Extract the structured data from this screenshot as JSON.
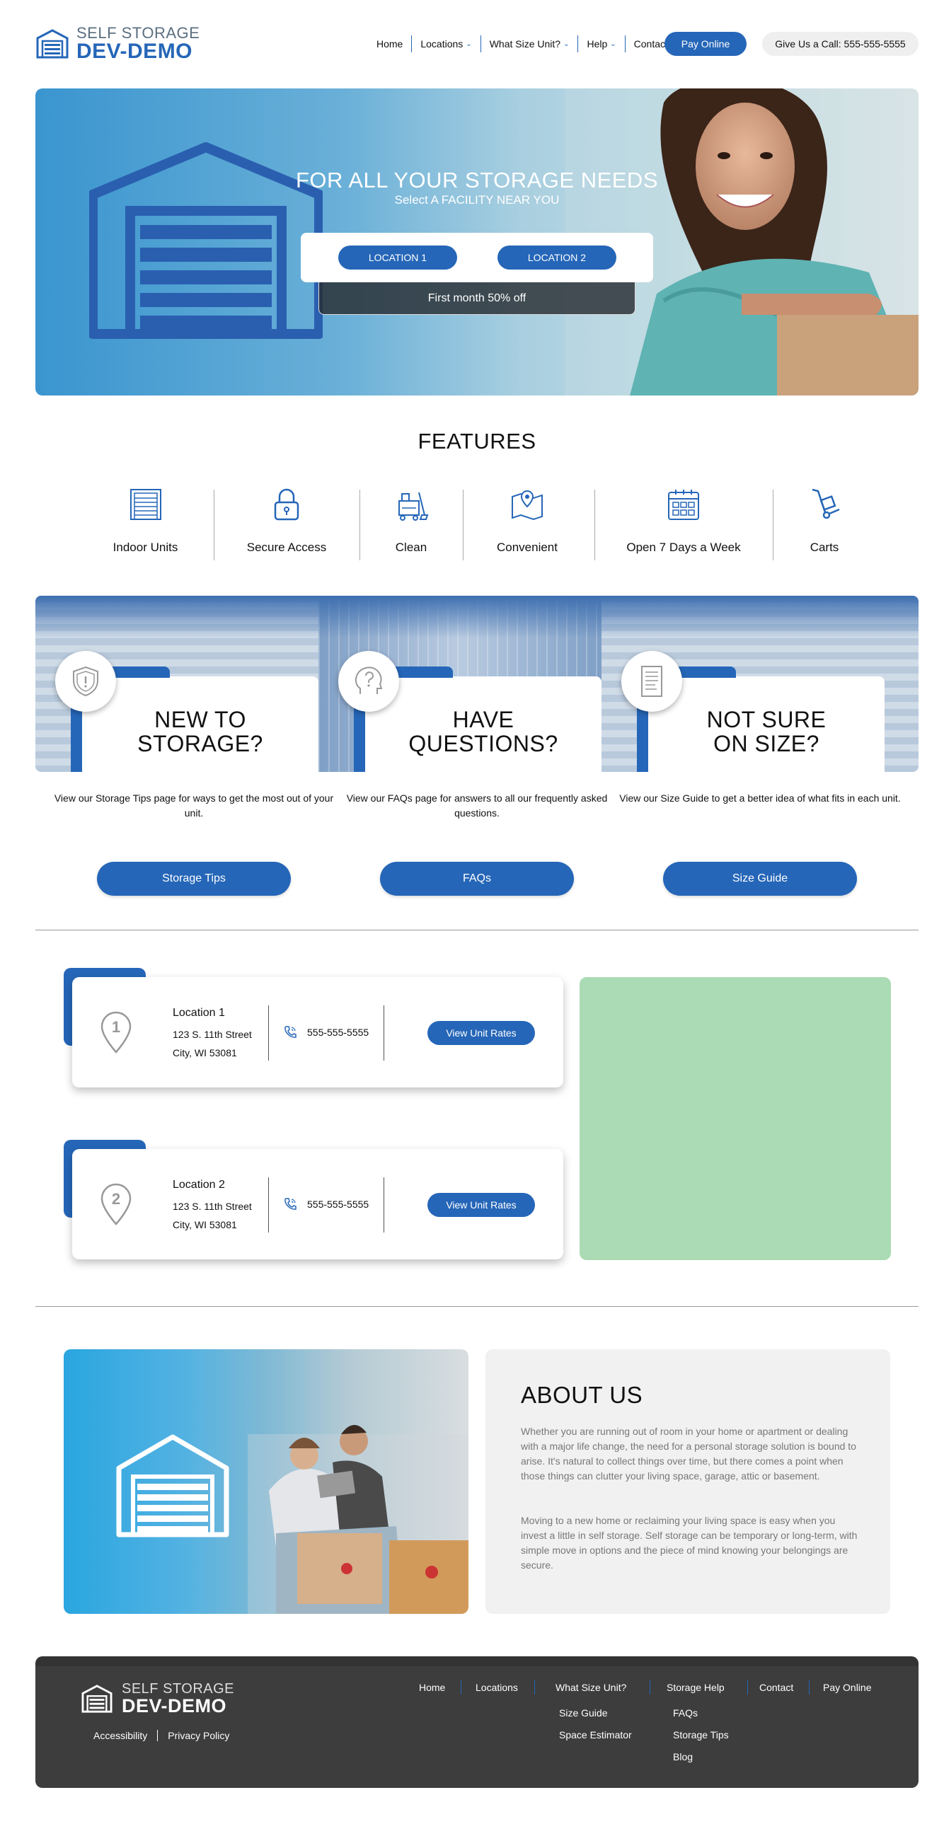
{
  "colors": {
    "accent": "#2566b8",
    "footer_bg": "#3d3d3d",
    "map_bg": "#aadbb4",
    "about_bg": "#f1f1f1"
  },
  "header": {
    "logo_line1": "SELF STORAGE",
    "logo_line2": "DEV-DEMO",
    "nav": [
      {
        "label": "Home",
        "dropdown": false
      },
      {
        "label": "Locations",
        "dropdown": true
      },
      {
        "label": "What Size Unit?",
        "dropdown": true
      },
      {
        "label": "Help",
        "dropdown": true
      },
      {
        "label": "Contact",
        "dropdown": false
      }
    ],
    "pay_label": "Pay Online",
    "call_label": "Give Us a Call: 555-555-5555"
  },
  "hero": {
    "title": "FOR ALL YOUR STORAGE NEEDS",
    "subtitle": "Select A FACILITY NEAR YOU",
    "locations": [
      "LOCATION 1",
      "LOCATION 2"
    ],
    "promo": "First month 50% off"
  },
  "features": {
    "title": "FEATURES",
    "items": [
      {
        "label": "Indoor Units",
        "icon": "garage-door-icon"
      },
      {
        "label": "Secure Access",
        "icon": "padlock-icon"
      },
      {
        "label": "Clean",
        "icon": "cleaning-cart-icon"
      },
      {
        "label": "Convenient",
        "icon": "map-pin-icon"
      },
      {
        "label": "Open 7 Days a Week",
        "icon": "calendar-icon"
      },
      {
        "label": "Carts",
        "icon": "hand-truck-icon"
      }
    ]
  },
  "info": [
    {
      "title_line1": "NEW TO",
      "title_line2": "STORAGE?",
      "icon": "shield-icon",
      "desc": "View our Storage Tips page for ways to get the most out of your unit.",
      "button": "Storage Tips"
    },
    {
      "title_line1": "HAVE",
      "title_line2": "QUESTIONS?",
      "icon": "question-head-icon",
      "desc": "View our FAQs page for answers to all our frequently asked questions.",
      "button": "FAQs"
    },
    {
      "title_line1": "NOT SURE",
      "title_line2": "ON SIZE?",
      "icon": "document-icon",
      "desc": "View our Size Guide to get a better idea of what fits in each unit.",
      "button": "Size Guide"
    }
  ],
  "locations": [
    {
      "number": "1",
      "name": "Location 1",
      "street": "123 S. 11th Street",
      "city": "City, WI 53081",
      "phone": "555-555-5555",
      "button": "View Unit Rates"
    },
    {
      "number": "2",
      "name": "Location 2",
      "street": "123 S. 11th Street",
      "city": "City, WI 53081",
      "phone": "555-555-5555",
      "button": "View Unit Rates"
    }
  ],
  "about": {
    "title": "ABOUT US",
    "p1": "Whether you are running out of room in your home or apartment or dealing with a major life change, the need for a personal storage solution is bound to arise. It's natural to collect things over time, but there comes a point when those things can clutter your living space, garage, attic or basement.",
    "p2": "Moving to a new home or reclaiming your living space is easy when you invest a little in self storage. Self storage can be temporary or long-term, with simple move in options and the piece of mind knowing your belongings are secure."
  },
  "footer": {
    "logo_line1": "SELF STORAGE",
    "logo_line2": "DEV-DEMO",
    "legal": [
      "Accessibility",
      "Privacy Policy"
    ],
    "nav": [
      "Home",
      "Locations",
      "What Size Unit?",
      "Storage Help",
      "Contact",
      "Pay Online"
    ],
    "size_sub": [
      "Size Guide",
      "Space Estimator"
    ],
    "help_sub": [
      "FAQs",
      "Storage Tips",
      "Blog"
    ]
  }
}
